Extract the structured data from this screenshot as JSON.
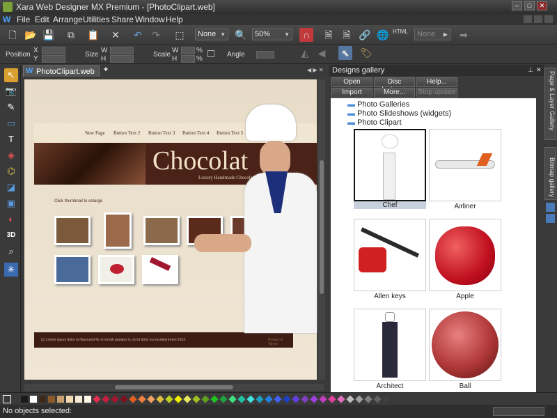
{
  "app": {
    "title": "Xara Web Designer MX Premium - [PhotoClipart.web]",
    "min": "–",
    "max": "□",
    "close": "✕"
  },
  "menu": {
    "logo": "W",
    "items": [
      "File",
      "Edit",
      "Arrange",
      "Utilities",
      "Share",
      "Window",
      "Help"
    ]
  },
  "toolbar": {
    "quality_combo": "None",
    "zoom_combo": "50%",
    "html_label": "HTML",
    "none_combo": "None"
  },
  "props": {
    "position": "Position",
    "x": "X",
    "y": "Y",
    "size": "Size",
    "w": "W",
    "h": "H",
    "scale": "Scale",
    "percent": "%",
    "angle": "Angle"
  },
  "doc": {
    "tab": "PhotoClipart.web",
    "tab_icon": "W",
    "new_tab": "+"
  },
  "site": {
    "nav": [
      "New Page",
      "Button Text 2",
      "Button Text 3",
      "Button Text 4",
      "Button Text 5"
    ],
    "banner_title": "Chocolat",
    "banner_sub": "Luxury Handmade Chocolates at",
    "hint": "Click thumbnail to enlarge",
    "footer": "(c) Lorem ipsum dolor sit flavoured for in month pariatur in, ed ut dolor eu exceted lorem 2012.",
    "footer_right": "Privacy & Terms"
  },
  "panel": {
    "title": "Designs gallery",
    "buttons": [
      "Open",
      "Disc designs...",
      "Help...",
      "Import",
      "More...",
      "Stop update"
    ],
    "folders": [
      "Photo Galleries",
      "Photo Slideshows (widgets)",
      "Photo Clipart"
    ],
    "items": [
      "Chef",
      "Airliner",
      "Allen keys",
      "Apple",
      "Architect",
      "Ball"
    ],
    "side_tabs": [
      "Page & Layer Gallery",
      "Bitmap gallery"
    ]
  },
  "status": {
    "text": "No objects selected:"
  },
  "palette": [
    "#1a1a1a",
    "#ffffff",
    "#3d2a1a",
    "#8a5a2a",
    "#c8a070",
    "#f0d8b0",
    "#f5ead5",
    "#fff8e8",
    "#e03050",
    "#c02040",
    "#a01830",
    "#801020",
    "#e06020",
    "#f08040",
    "#f0a060",
    "#e0c040",
    "#c0d020",
    "#f0f000",
    "#e8e860",
    "#a0c020",
    "#60a020",
    "#20c020",
    "#20a040",
    "#40e080",
    "#20c0a0",
    "#40e0e0",
    "#20a0c0",
    "#2080e0",
    "#4060f0",
    "#2040c0",
    "#6040e0",
    "#8040c0",
    "#a040e0",
    "#c040c0",
    "#e040a0",
    "#e070c0",
    "#c0c0c0",
    "#a0a0a0",
    "#808080",
    "#606060",
    "#404040"
  ],
  "colors": {
    "accent": "#4da3ff",
    "banner": "#4a2218",
    "footer": "#3e1c14"
  }
}
